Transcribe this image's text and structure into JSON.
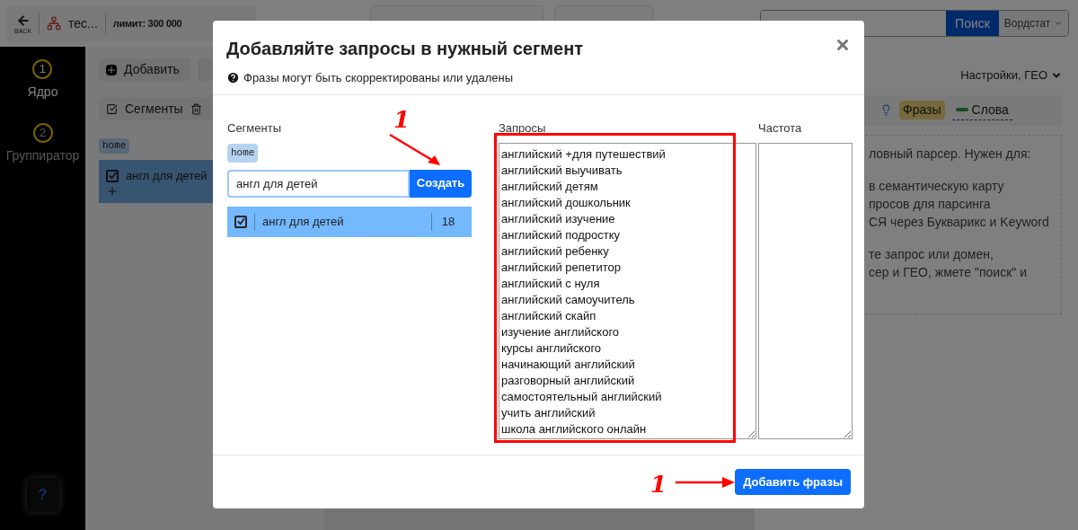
{
  "topbar": {
    "back_label": "BACK",
    "project": "тес...",
    "limit": "лимит: 300 000",
    "search": {
      "button": "Поиск",
      "source": "Вордстат"
    }
  },
  "sidebar": {
    "items": [
      {
        "number": "1",
        "label": "Ядро",
        "selected": true
      },
      {
        "number": "2",
        "label": "Группиратор",
        "selected": false
      }
    ],
    "help": "?"
  },
  "workspace": {
    "add_button": "Добавить",
    "segments_label": "Сегменты",
    "tag": "home",
    "segments": [
      {
        "name": "англ для детей",
        "checked": true
      }
    ]
  },
  "right_panel": {
    "settings": "Настройки, ГЕО",
    "modes": [
      {
        "label": "Фразы",
        "selected": true
      },
      {
        "label": "Слова",
        "selected": false
      }
    ],
    "description": [
      "ловный парсер. Нужен для:",
      "в семантическую карту",
      "просов для парсинга",
      "СЯ через Букварикс и Keyword",
      "те запрос или домен,",
      "сер и ГЕО, жмете \"поиск\" и"
    ]
  },
  "modal": {
    "title": "Добавляйте запросы в нужный сегмент",
    "hint": "Фразы могут быть скорректированы или удалены",
    "segments_label": "Сегменты",
    "tag": "home",
    "new_segment": "англ для детей",
    "create_button": "Создать",
    "segments": [
      {
        "name": "англ для детей",
        "count": "18",
        "checked": true
      }
    ],
    "queries_label": "Запросы",
    "queries": [
      "английский +для путешествий",
      "английский выучивать",
      "английский детям",
      "английский дошкольник",
      "английский изучение",
      "английский подростку",
      "английский ребенку",
      "английский репетитор",
      "английский с нуля",
      "английский самоучитель",
      "английский скайп",
      "изучение английского",
      "курсы английского",
      "начинающий английский",
      "разговорный английский",
      "самостоятельный английский",
      "учить английский",
      "школа английского онлайн"
    ],
    "frequency_label": "Частота",
    "submit_button": "Добавить фразы"
  },
  "annotations": [
    {
      "text": "1"
    },
    {
      "text": "1"
    }
  ]
}
